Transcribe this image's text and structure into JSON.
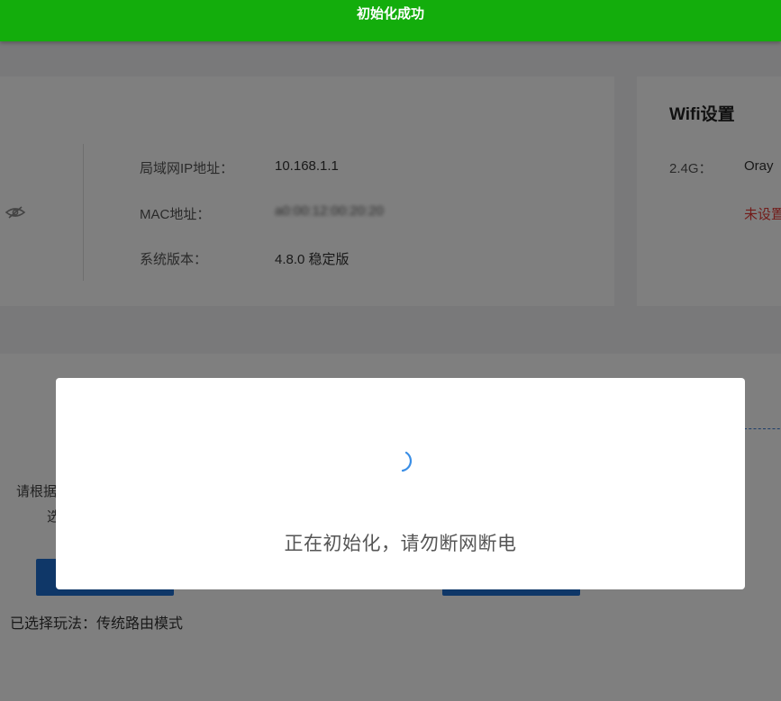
{
  "toast": {
    "message": "初始化成功",
    "color": "#13ad0c"
  },
  "device_info": {
    "rows": [
      {
        "label": "局域网IP地址：",
        "value": "10.168.1.1"
      },
      {
        "label": "MAC地址：",
        "value": "a0:00:12:00:20:20"
      },
      {
        "label": "系统版本：",
        "value": "4.8.0 稳定版"
      }
    ],
    "eye_icon": "eye-hidden-icon"
  },
  "wifi": {
    "title": "Wifi设置",
    "band_label": "2.4G：",
    "ssid": "Oray",
    "unset": "未设置"
  },
  "mode": {
    "text_line1": "请根据",
    "text_line2": "选",
    "selected": "已选择玩法：传统路由模式"
  },
  "modal": {
    "spinner_icon": "loading-spinner-icon",
    "message": "正在初始化，请勿断网断电"
  },
  "colors": {
    "accent": "#1f6fd1",
    "error": "#e53935",
    "spinner": "#3a8ee6"
  }
}
